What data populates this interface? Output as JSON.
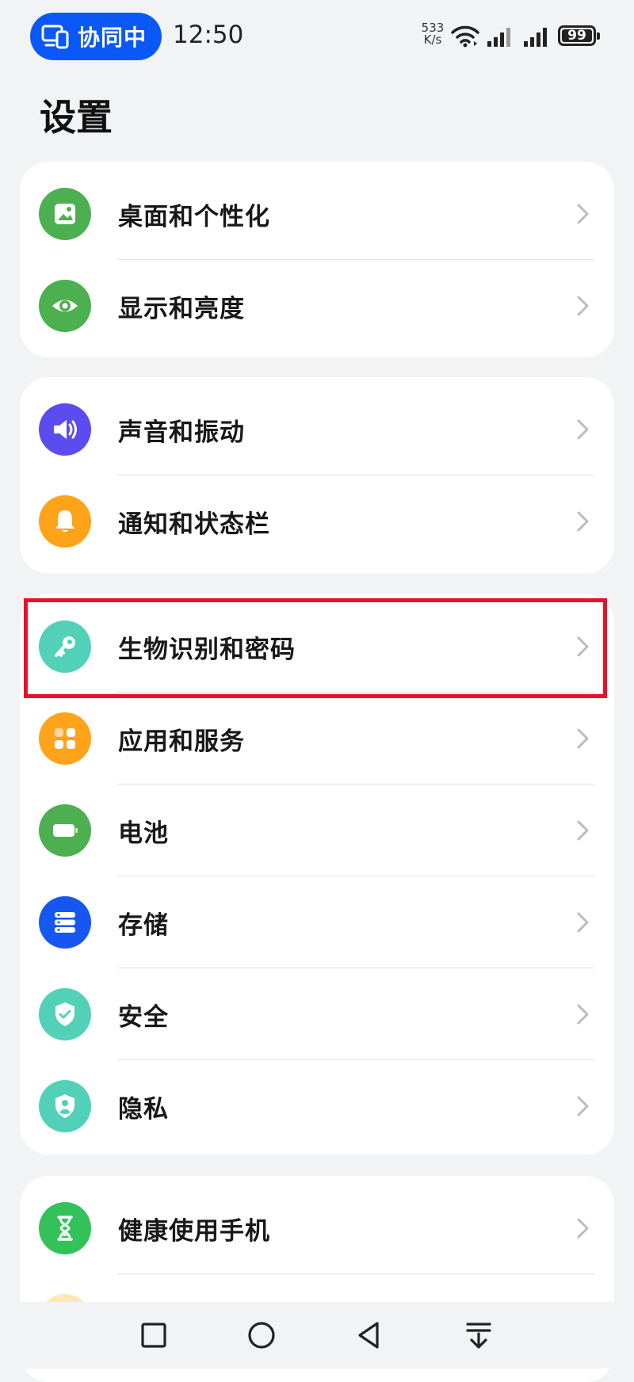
{
  "status_bar": {
    "collab_label": "协同中",
    "time": "12:50",
    "net_speed_value": "533",
    "net_speed_unit": "K/s",
    "battery_level": "99"
  },
  "page_title": "设置",
  "groups": [
    {
      "items": [
        {
          "label": "桌面和个性化",
          "icon": "wallpaper-icon",
          "color": "#4caf50"
        },
        {
          "label": "显示和亮度",
          "icon": "eye-icon",
          "color": "#4caf50"
        }
      ]
    },
    {
      "items": [
        {
          "label": "声音和振动",
          "icon": "speaker-icon",
          "color": "#5b4cf0"
        },
        {
          "label": "通知和状态栏",
          "icon": "bell-icon",
          "color": "#ffa31a"
        }
      ]
    },
    {
      "items": [
        {
          "label": "生物识别和密码",
          "icon": "key-icon",
          "color": "#52d1b8"
        },
        {
          "label": "应用和服务",
          "icon": "apps-grid-icon",
          "color": "#ffa31a"
        },
        {
          "label": "电池",
          "icon": "battery-icon",
          "color": "#4caf50"
        },
        {
          "label": "存储",
          "icon": "storage-icon",
          "color": "#1557f0"
        },
        {
          "label": "安全",
          "icon": "shield-check-icon",
          "color": "#52d1b8"
        },
        {
          "label": "隐私",
          "icon": "privacy-shield-icon",
          "color": "#52d1b8"
        }
      ]
    },
    {
      "items": [
        {
          "label": "健康使用手机",
          "icon": "hourglass-icon",
          "color": "#33c15a"
        }
      ]
    }
  ],
  "highlight_color": "#e8102a"
}
